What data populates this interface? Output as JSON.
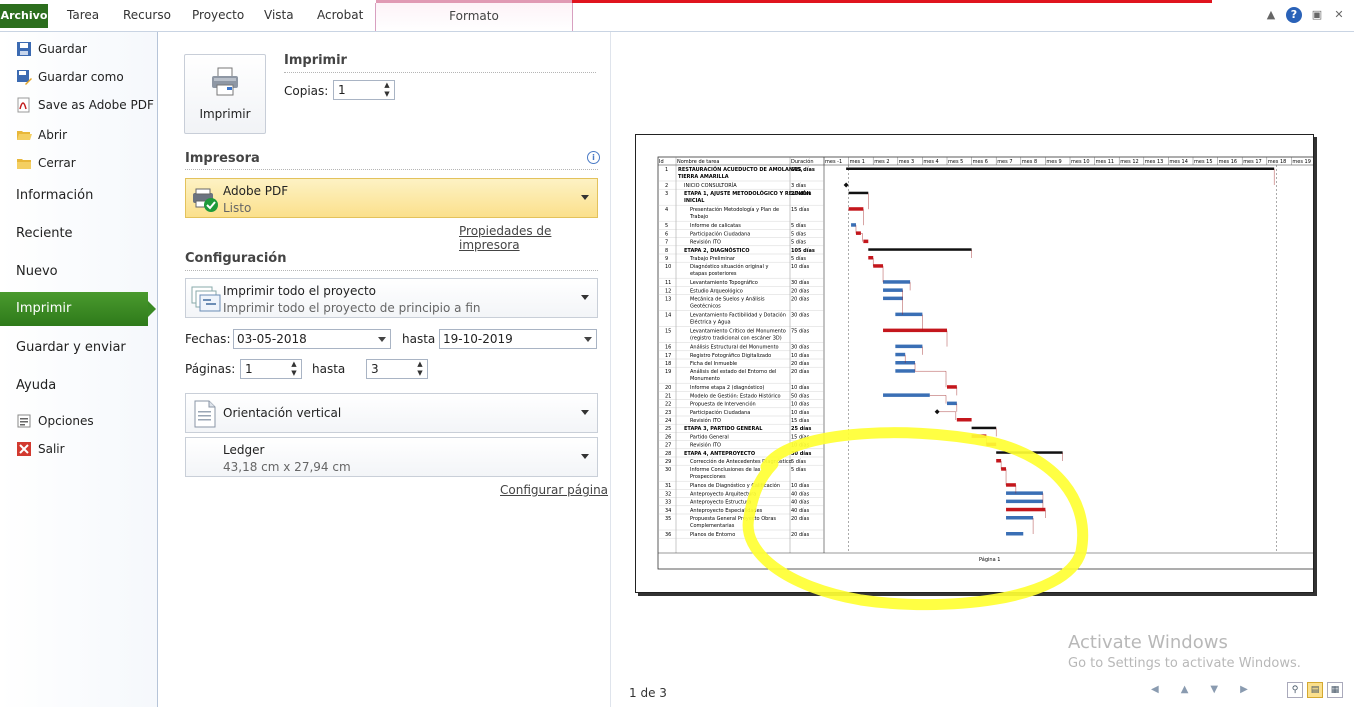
{
  "ribbon": {
    "tabs": [
      "Archivo",
      "Tarea",
      "Recurso",
      "Proyecto",
      "Vista",
      "Acrobat"
    ],
    "context_tab": "Formato"
  },
  "sidebar": {
    "items": [
      {
        "label": "Guardar",
        "icon": "save-icon"
      },
      {
        "label": "Guardar como",
        "icon": "save-as-icon"
      },
      {
        "label": "Save as Adobe PDF",
        "icon": "pdf-icon"
      },
      {
        "label": "Abrir",
        "icon": "folder-open-icon"
      },
      {
        "label": "Cerrar",
        "icon": "folder-close-icon"
      }
    ],
    "sections": [
      "Información",
      "Reciente",
      "Nuevo",
      "Imprimir",
      "Guardar y enviar",
      "Ayuda"
    ],
    "active": "Imprimir",
    "bottom_items": [
      {
        "label": "Opciones",
        "icon": "options-icon"
      },
      {
        "label": "Salir",
        "icon": "exit-icon"
      }
    ]
  },
  "print": {
    "button_label": "Imprimir",
    "title": "Imprimir",
    "copies_label": "Copias:",
    "copies_value": "1"
  },
  "printer": {
    "section_title": "Impresora",
    "name": "Adobe PDF",
    "status": "Listo",
    "properties_link": "Propiedades de impresora"
  },
  "config": {
    "section_title": "Configuración",
    "scope_title": "Imprimir todo el proyecto",
    "scope_desc": "Imprimir todo el proyecto de principio a fin",
    "dates_label": "Fechas:",
    "date_from": "03-05-2018",
    "until_label": "hasta",
    "date_to": "19-10-2019",
    "pages_label": "Páginas:",
    "page_from": "1",
    "page_to": "3",
    "orientation": "Orientación vertical",
    "paper_name": "Ledger",
    "paper_size": "43,18 cm x 27,94 cm",
    "page_setup_link": "Configurar página"
  },
  "preview": {
    "page_indicator": "1 de 3",
    "footer": "Página 1",
    "watermark_title": "Activate Windows",
    "watermark_sub": "Go to Settings to activate Windows."
  },
  "gantt": {
    "col_headers": [
      "Id",
      "Nombre de tarea",
      "Duración"
    ],
    "months": [
      "mes -1",
      "mes 1",
      "mes 2",
      "mes 3",
      "mes 4",
      "mes 5",
      "mes 6",
      "mes 7",
      "mes 8",
      "mes 9",
      "mes 10",
      "mes 11",
      "mes 12",
      "mes 13",
      "mes 14",
      "mes 15",
      "mes 16",
      "mes 17",
      "mes 18",
      "mes 19"
    ],
    "rows": [
      {
        "id": "1",
        "name": "RESTAURACIÓN ACUEDUCTO DE AMOLANAS, TIERRA AMARILLA",
        "dur": "535 días",
        "summary": true,
        "indent": 0,
        "start": 0.9,
        "len": 17.4,
        "color": "sum"
      },
      {
        "id": "2",
        "name": "INICIO CONSULTORÍA",
        "dur": "3 días",
        "summary": false,
        "indent": 1,
        "start": 0.9,
        "len": 0.1,
        "color": "milestone"
      },
      {
        "id": "3",
        "name": "ETAPA 1, AJUSTE METODOLÓGICO Y REUNIÓN INICIAL",
        "dur": "20 días",
        "summary": true,
        "indent": 1,
        "start": 1.0,
        "len": 0.8,
        "color": "sum"
      },
      {
        "id": "4",
        "name": "Presentación Metodología y Plan de Trabajo",
        "dur": "15 días",
        "summary": false,
        "indent": 2,
        "start": 1.0,
        "len": 0.6,
        "color": "red"
      },
      {
        "id": "5",
        "name": "Informe de calicatas",
        "dur": "5 días",
        "summary": false,
        "indent": 2,
        "start": 1.1,
        "len": 0.2,
        "color": "blue"
      },
      {
        "id": "6",
        "name": "Participación Ciudadana",
        "dur": "5 días",
        "summary": false,
        "indent": 2,
        "start": 1.3,
        "len": 0.2,
        "color": "red"
      },
      {
        "id": "7",
        "name": "Revisión ITO",
        "dur": "5 días",
        "summary": false,
        "indent": 2,
        "start": 1.6,
        "len": 0.2,
        "color": "red"
      },
      {
        "id": "8",
        "name": "ETAPA 2, DIAGNÓSTICO",
        "dur": "105 días",
        "summary": true,
        "indent": 1,
        "start": 1.8,
        "len": 4.2,
        "color": "sum"
      },
      {
        "id": "9",
        "name": "Trabajo Preliminar",
        "dur": "5 días",
        "summary": false,
        "indent": 2,
        "start": 1.8,
        "len": 0.2,
        "color": "red"
      },
      {
        "id": "10",
        "name": "Diagnóstico situación original y etapas posteriores",
        "dur": "10 días",
        "summary": false,
        "indent": 2,
        "start": 2.0,
        "len": 0.4,
        "color": "red"
      },
      {
        "id": "11",
        "name": "Levantamiento Topográfico",
        "dur": "30 días",
        "summary": false,
        "indent": 2,
        "start": 2.4,
        "len": 1.1,
        "color": "blue"
      },
      {
        "id": "12",
        "name": "Estudio Arqueológico",
        "dur": "20 días",
        "summary": false,
        "indent": 2,
        "start": 2.4,
        "len": 0.8,
        "color": "blue"
      },
      {
        "id": "13",
        "name": "Mecánica de Suelos y Análisis Geotécnicos",
        "dur": "20 días",
        "summary": false,
        "indent": 2,
        "start": 2.4,
        "len": 0.8,
        "color": "blue"
      },
      {
        "id": "14",
        "name": "Levantamiento Factibilidad y Dotación Eléctrica y Agua",
        "dur": "30 días",
        "summary": false,
        "indent": 2,
        "start": 2.9,
        "len": 1.1,
        "color": "blue"
      },
      {
        "id": "15",
        "name": "Levantamiento Crítico del Monumento (registro tradicional con escáner 3D)",
        "dur": "75 días",
        "summary": false,
        "indent": 2,
        "start": 2.4,
        "len": 2.6,
        "color": "red"
      },
      {
        "id": "16",
        "name": "Análisis Estructural del Monumento",
        "dur": "30 días",
        "summary": false,
        "indent": 2,
        "start": 2.9,
        "len": 1.1,
        "color": "blue"
      },
      {
        "id": "17",
        "name": "Registro Fotográfico Digitalizado",
        "dur": "10 días",
        "summary": false,
        "indent": 2,
        "start": 2.9,
        "len": 0.4,
        "color": "blue"
      },
      {
        "id": "18",
        "name": "Ficha del Inmueble",
        "dur": "20 días",
        "summary": false,
        "indent": 2,
        "start": 2.9,
        "len": 0.8,
        "color": "blue"
      },
      {
        "id": "19",
        "name": "Análisis del estado del Entorno del Monumento",
        "dur": "20 días",
        "summary": false,
        "indent": 2,
        "start": 2.9,
        "len": 0.8,
        "color": "blue"
      },
      {
        "id": "20",
        "name": "Informe etapa 2 (diagnóstico)",
        "dur": "10 días",
        "summary": false,
        "indent": 2,
        "start": 5.0,
        "len": 0.4,
        "color": "red"
      },
      {
        "id": "21",
        "name": "Modelo de Gestión: Estado Histórico",
        "dur": "50 días",
        "summary": false,
        "indent": 2,
        "start": 2.4,
        "len": 1.9,
        "color": "blue"
      },
      {
        "id": "22",
        "name": "Propuesta de Intervención",
        "dur": "10 días",
        "summary": false,
        "indent": 2,
        "start": 5.0,
        "len": 0.4,
        "color": "blue"
      },
      {
        "id": "23",
        "name": "Participación Ciudadana",
        "dur": "10 días",
        "summary": false,
        "indent": 2,
        "start": 4.6,
        "len": 0.1,
        "color": "milestone"
      },
      {
        "id": "24",
        "name": "Revisión ITO",
        "dur": "15 días",
        "summary": false,
        "indent": 2,
        "start": 5.4,
        "len": 0.6,
        "color": "red"
      },
      {
        "id": "25",
        "name": "ETAPA 3, PARTIDO GENERAL",
        "dur": "25 días",
        "summary": true,
        "indent": 1,
        "start": 6.0,
        "len": 1.0,
        "color": "sum"
      },
      {
        "id": "26",
        "name": "Partido General",
        "dur": "15 días",
        "summary": false,
        "indent": 2,
        "start": 6.0,
        "len": 0.6,
        "color": "red"
      },
      {
        "id": "27",
        "name": "Revisión ITO",
        "dur": "10 días",
        "summary": false,
        "indent": 2,
        "start": 6.6,
        "len": 0.4,
        "color": "red"
      },
      {
        "id": "28",
        "name": "ETAPA 4, ANTEPROYECTO",
        "dur": "30 días",
        "summary": true,
        "indent": 1,
        "start": 7.0,
        "len": 2.7,
        "color": "sum"
      },
      {
        "id": "29",
        "name": "Corrección de Antecedentes Diagnóstico",
        "dur": "5 días",
        "summary": false,
        "indent": 2,
        "start": 7.0,
        "len": 0.2,
        "color": "red"
      },
      {
        "id": "30",
        "name": "Informe Conclusiones de las Prospecciones",
        "dur": "5 días",
        "summary": false,
        "indent": 2,
        "start": 7.2,
        "len": 0.2,
        "color": "red"
      },
      {
        "id": "31",
        "name": "Planos de Diagnóstico y Calificación",
        "dur": "10 días",
        "summary": false,
        "indent": 2,
        "start": 7.4,
        "len": 0.4,
        "color": "red"
      },
      {
        "id": "32",
        "name": "Anteproyecto Arquitectura",
        "dur": "40 días",
        "summary": false,
        "indent": 2,
        "start": 7.4,
        "len": 1.5,
        "color": "blue"
      },
      {
        "id": "33",
        "name": "Anteproyecto Estructura",
        "dur": "40 días",
        "summary": false,
        "indent": 2,
        "start": 7.4,
        "len": 1.5,
        "color": "blue"
      },
      {
        "id": "34",
        "name": "Anteproyecto Especialidades",
        "dur": "40 días",
        "summary": false,
        "indent": 2,
        "start": 7.4,
        "len": 1.6,
        "color": "red"
      },
      {
        "id": "35",
        "name": "Propuesta General Proyecto Obras Complementarias",
        "dur": "20 días",
        "summary": false,
        "indent": 2,
        "start": 7.4,
        "len": 1.1,
        "color": "blue"
      },
      {
        "id": "36",
        "name": "Planos de Entorno",
        "dur": "20 días",
        "summary": false,
        "indent": 2,
        "start": 7.4,
        "len": 0.7,
        "color": "blue"
      }
    ]
  },
  "colors": {
    "accent_green": "#2e7a1a",
    "highlight": "#ffff33",
    "task_red": "#c4161c",
    "task_blue": "#3a6fb5",
    "summary_black": "#111111"
  }
}
